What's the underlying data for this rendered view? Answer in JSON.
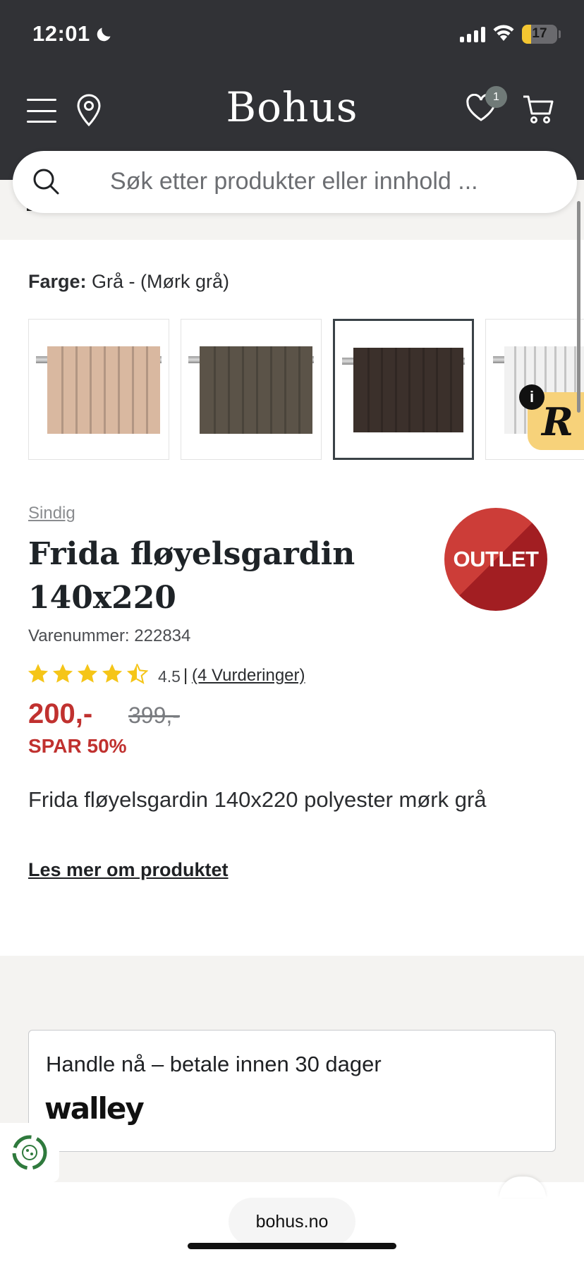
{
  "status": {
    "time": "12:01",
    "battery": "17",
    "icons": [
      "moon-icon",
      "signal-icon",
      "wifi-icon",
      "battery-icon"
    ]
  },
  "header": {
    "logo": "Bohus",
    "wishlist_count": "1",
    "icons": [
      "menu-icon",
      "location-pin-icon",
      "heart-icon",
      "cart-icon"
    ]
  },
  "search": {
    "placeholder": "Søk etter produkter eller innhold ..."
  },
  "product": {
    "color_label": "Farge:",
    "color_value": "Grå - (Mørk grå)",
    "swatches": [
      {
        "name": "beige",
        "color": "#d9b8a0",
        "selected": false
      },
      {
        "name": "brown-grey",
        "color": "#5b5348",
        "selected": false
      },
      {
        "name": "dark-grey",
        "color": "#3b302b",
        "selected": true
      },
      {
        "name": "white",
        "color": "#f1f1f1",
        "selected": false
      }
    ],
    "brand": "Sindig",
    "title": "Frida fløyelsgardin 140x220",
    "badge": "OUTLET",
    "sku": "Varenummer: 222834",
    "rating": 4.5,
    "rating_text": "4.5",
    "rating_sep": "|",
    "reviews_link": "(4 Vurderinger)",
    "price": "200,-",
    "old_price": "399,-",
    "save": "SPAR 50%",
    "description": "Frida fløyelsgardin 140x220 polyester mørk grå",
    "read_more": "Les mer om produktet"
  },
  "payment": {
    "text": "Handle nå – betale innen 30 dager",
    "logo_text": "walley"
  },
  "browser": {
    "url": "bohus.no"
  },
  "colors": {
    "header_bg": "#313236",
    "sale_red": "#c0312f",
    "star_yellow": "#f5c518",
    "badge_yellow": "#f7d27a"
  }
}
